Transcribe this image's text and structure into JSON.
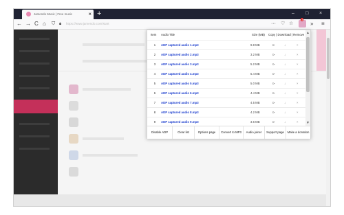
{
  "tab": {
    "title": "Jamendo Music | Free music",
    "close": "×",
    "new_tab": "+"
  },
  "window": {
    "minimize": "–",
    "maximize": "□",
    "close": "×"
  },
  "nav": {
    "back": "←",
    "forward": "→",
    "reload": "C",
    "home": "⌂",
    "url": "https://www.jamendo.com/start",
    "more": "···",
    "extensions_badge": "3",
    "overflow": "»",
    "menu": "≡"
  },
  "popup": {
    "headers": {
      "item": "Item",
      "title": "Audio Title",
      "size": "Size (MB)",
      "actions": "Copy | Download | Remove"
    },
    "rows": [
      {
        "num": "1",
        "title": "ADP captured audio 1.mp3",
        "size": "9.8 MB"
      },
      {
        "num": "2",
        "title": "ADP captured audio 2.mp3",
        "size": "3.2 MB"
      },
      {
        "num": "3",
        "title": "ADP captured audio 3.mp3",
        "size": "5.2 MB"
      },
      {
        "num": "4",
        "title": "ADP captured audio 4.mp3",
        "size": "5.4 MB"
      },
      {
        "num": "5",
        "title": "ADP captured audio 5.mp3",
        "size": "5.0 MB"
      },
      {
        "num": "6",
        "title": "ADP captured audio 6.mp3",
        "size": "4.4 MB"
      },
      {
        "num": "7",
        "title": "ADP captured audio 7.mp3",
        "size": "4.5 MB"
      },
      {
        "num": "8",
        "title": "ADP captured audio 8.mp3",
        "size": "4.2 MB"
      },
      {
        "num": "9",
        "title": "ADP captured audio 9.mp3",
        "size": "3.6 MB"
      }
    ],
    "icons": {
      "play": "⊳",
      "download": "↓",
      "remove": "×"
    },
    "buttons": [
      "Disable ADP",
      "Clear list",
      "Options page",
      "Convert to MP3",
      "Audio joiner",
      "Support page",
      "Make a donation"
    ]
  }
}
